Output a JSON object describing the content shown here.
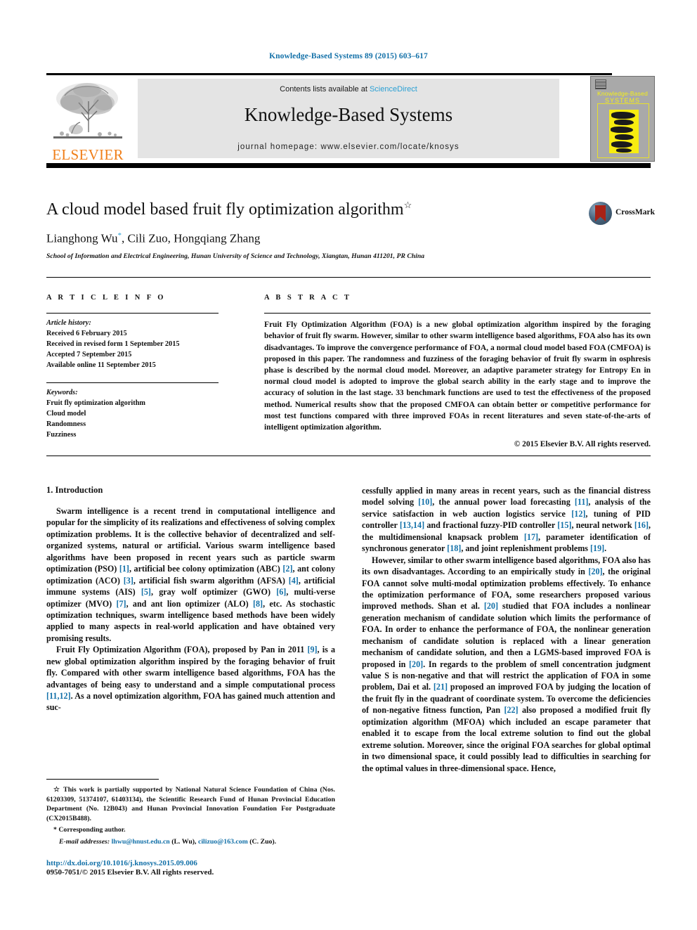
{
  "colors": {
    "link_blue": "#1270a8",
    "sciencedirect_blue": "#2aa0d4",
    "elsevier_orange": "#f07f1a",
    "masthead_gray": "#e4e4e4",
    "cover_gray": "#a9a9a9",
    "cover_yellow": "#f7ec10",
    "crossmark_red": "#a82216"
  },
  "running_head": "Knowledge-Based Systems 89 (2015) 603–617",
  "masthead": {
    "contents_line_prefix": "Contents lists available at ",
    "sciencedirect": "ScienceDirect",
    "journal_name": "Knowledge-Based Systems",
    "homepage": "journal homepage: www.elsevier.com/locate/knosys",
    "publisher_wordmark": "ELSEVIER",
    "publisher_logo_icon": "elsevier-tree-icon",
    "cover_title_line1": "Knowledge-Based",
    "cover_title_line2": "SYSTEMS"
  },
  "article": {
    "title": "A cloud model based fruit fly optimization algorithm",
    "title_footnote_marker": "☆",
    "authors": "Lianghong Wu",
    "authors_corr_marker": "*",
    "authors_rest": ", Cili Zuo, Hongqiang Zhang",
    "affiliation": "School of Information and Electrical Engineering, Hunan University of Science and Technology, Xiangtan, Hunan 411201, PR China",
    "crossmark_label": "CrossMark",
    "crossmark_icon": "crossmark-icon"
  },
  "article_info": {
    "heading": "A R T I C L E   I N F O",
    "history_label": "Article history:",
    "history": [
      "Received 6 February 2015",
      "Received in revised form 1 September 2015",
      "Accepted 7 September 2015",
      "Available online 11 September 2015"
    ],
    "keywords_label": "Keywords:",
    "keywords": [
      "Fruit fly optimization algorithm",
      "Cloud model",
      "Randomness",
      "Fuzziness"
    ]
  },
  "abstract": {
    "heading": "A B S T R A C T",
    "text": "Fruit Fly Optimization Algorithm (FOA) is a new global optimization algorithm inspired by the foraging behavior of fruit fly swarm. However, similar to other swarm intelligence based algorithms, FOA also has its own disadvantages. To improve the convergence performance of FOA, a normal cloud model based FOA (CMFOA) is proposed in this paper. The randomness and fuzziness of the foraging behavior of fruit fly swarm in osphresis phase is described by the normal cloud model. Moreover, an adaptive parameter strategy for Entropy En in normal cloud model is adopted to improve the global search ability in the early stage and to improve the accuracy of solution in the last stage. 33 benchmark functions are used to test the effectiveness of the proposed method. Numerical results show that the proposed CMFOA can obtain better or competitive performance for most test functions compared with three improved FOAs in recent literatures and seven state-of-the-arts of intelligent optimization algorithm.",
    "copyright": "© 2015 Elsevier B.V. All rights reserved."
  },
  "body": {
    "section_title": "1. Introduction",
    "left_paragraphs": [
      "Swarm intelligence is a recent trend in computational intelligence and popular for the simplicity of its realizations and effectiveness of solving complex optimization problems. It is the collective behavior of decentralized and self-organized systems, natural or artificial. Various swarm intelligence based algorithms have been proposed in recent years such as particle swarm optimization (PSO) [1], artificial bee colony optimization (ABC) [2], ant colony optimization (ACO) [3], artificial fish swarm algorithm (AFSA) [4], artificial immune systems (AIS) [5], gray wolf optimizer (GWO) [6], multi-verse optimizer (MVO) [7], and ant lion optimizer (ALO) [8], etc. As stochastic optimization techniques, swarm intelligence based methods have been widely applied to many aspects in real-world application and have obtained very promising results.",
      "Fruit Fly Optimization Algorithm (FOA), proposed by Pan in 2011 [9], is a new global optimization algorithm inspired by the foraging behavior of fruit fly. Compared with other swarm intelligence based algorithms, FOA has the advantages of being easy to understand and a simple computational process [11,12]. As a novel optimization algorithm, FOA has gained much attention and suc-"
    ],
    "right_paragraphs": [
      "cessfully applied in many areas in recent years, such as the financial distress model solving [10], the annual power load forecasting [11], analysis of the service satisfaction in web auction logistics service [12], tuning of PID controller [13,14] and fractional fuzzy-PID controller [15], neural network [16], the multidimensional knapsack problem [17], parameter identification of synchronous generator [18], and joint replenishment problems [19].",
      "However, similar to other swarm intelligence based algorithms, FOA also has its own disadvantages. According to an empirically study in [20], the original FOA cannot solve multi-modal optimization problems effectively. To enhance the optimization performance of FOA, some researchers proposed various improved methods. Shan et al. [20] studied that FOA includes a nonlinear generation mechanism of candidate solution which limits the performance of FOA. In order to enhance the performance of FOA, the nonlinear generation mechanism of candidate solution is replaced with a linear generation mechanism of candidate solution, and then a LGMS-based improved FOA is proposed in [20]. In regards to the problem of smell concentration judgment value S is non-negative and that will restrict the application of FOA in some problem, Dai et al. [21] proposed an improved FOA by judging the location of the fruit fly in the quadrant of coordinate system. To overcome the deficiencies of non-negative fitness function, Pan [22] also proposed a modified fruit fly optimization algorithm (MFOA) which included an escape parameter that enabled it to escape from the local extreme solution to find out the global extreme solution. Moreover, since the original FOA searches for global optimal in two dimensional space, it could possibly lead to difficulties in searching for the optimal values in three-dimensional space. Hence,"
    ]
  },
  "footnotes": {
    "funding": "☆ This work is partially supported by National Natural Science Foundation of China (Nos. 61203309, 51374107, 61403134), the Scientific Research Fund of Hunan Provincial Education Department (No. 12B043) and Hunan Provincial Innovation Foundation For Postgraduate (CX2015B488).",
    "corresponding": "* Corresponding author.",
    "email_label": "E-mail addresses:",
    "email1": "lhwu@hnust.edu.cn",
    "email1_owner": "(L. Wu),",
    "email2": "cilizuo@163.com",
    "email2_owner": "(C. Zuo).",
    "doi": "http://dx.doi.org/10.1016/j.knosys.2015.09.006",
    "issn_line": "0950-7051/© 2015 Elsevier B.V. All rights reserved."
  }
}
